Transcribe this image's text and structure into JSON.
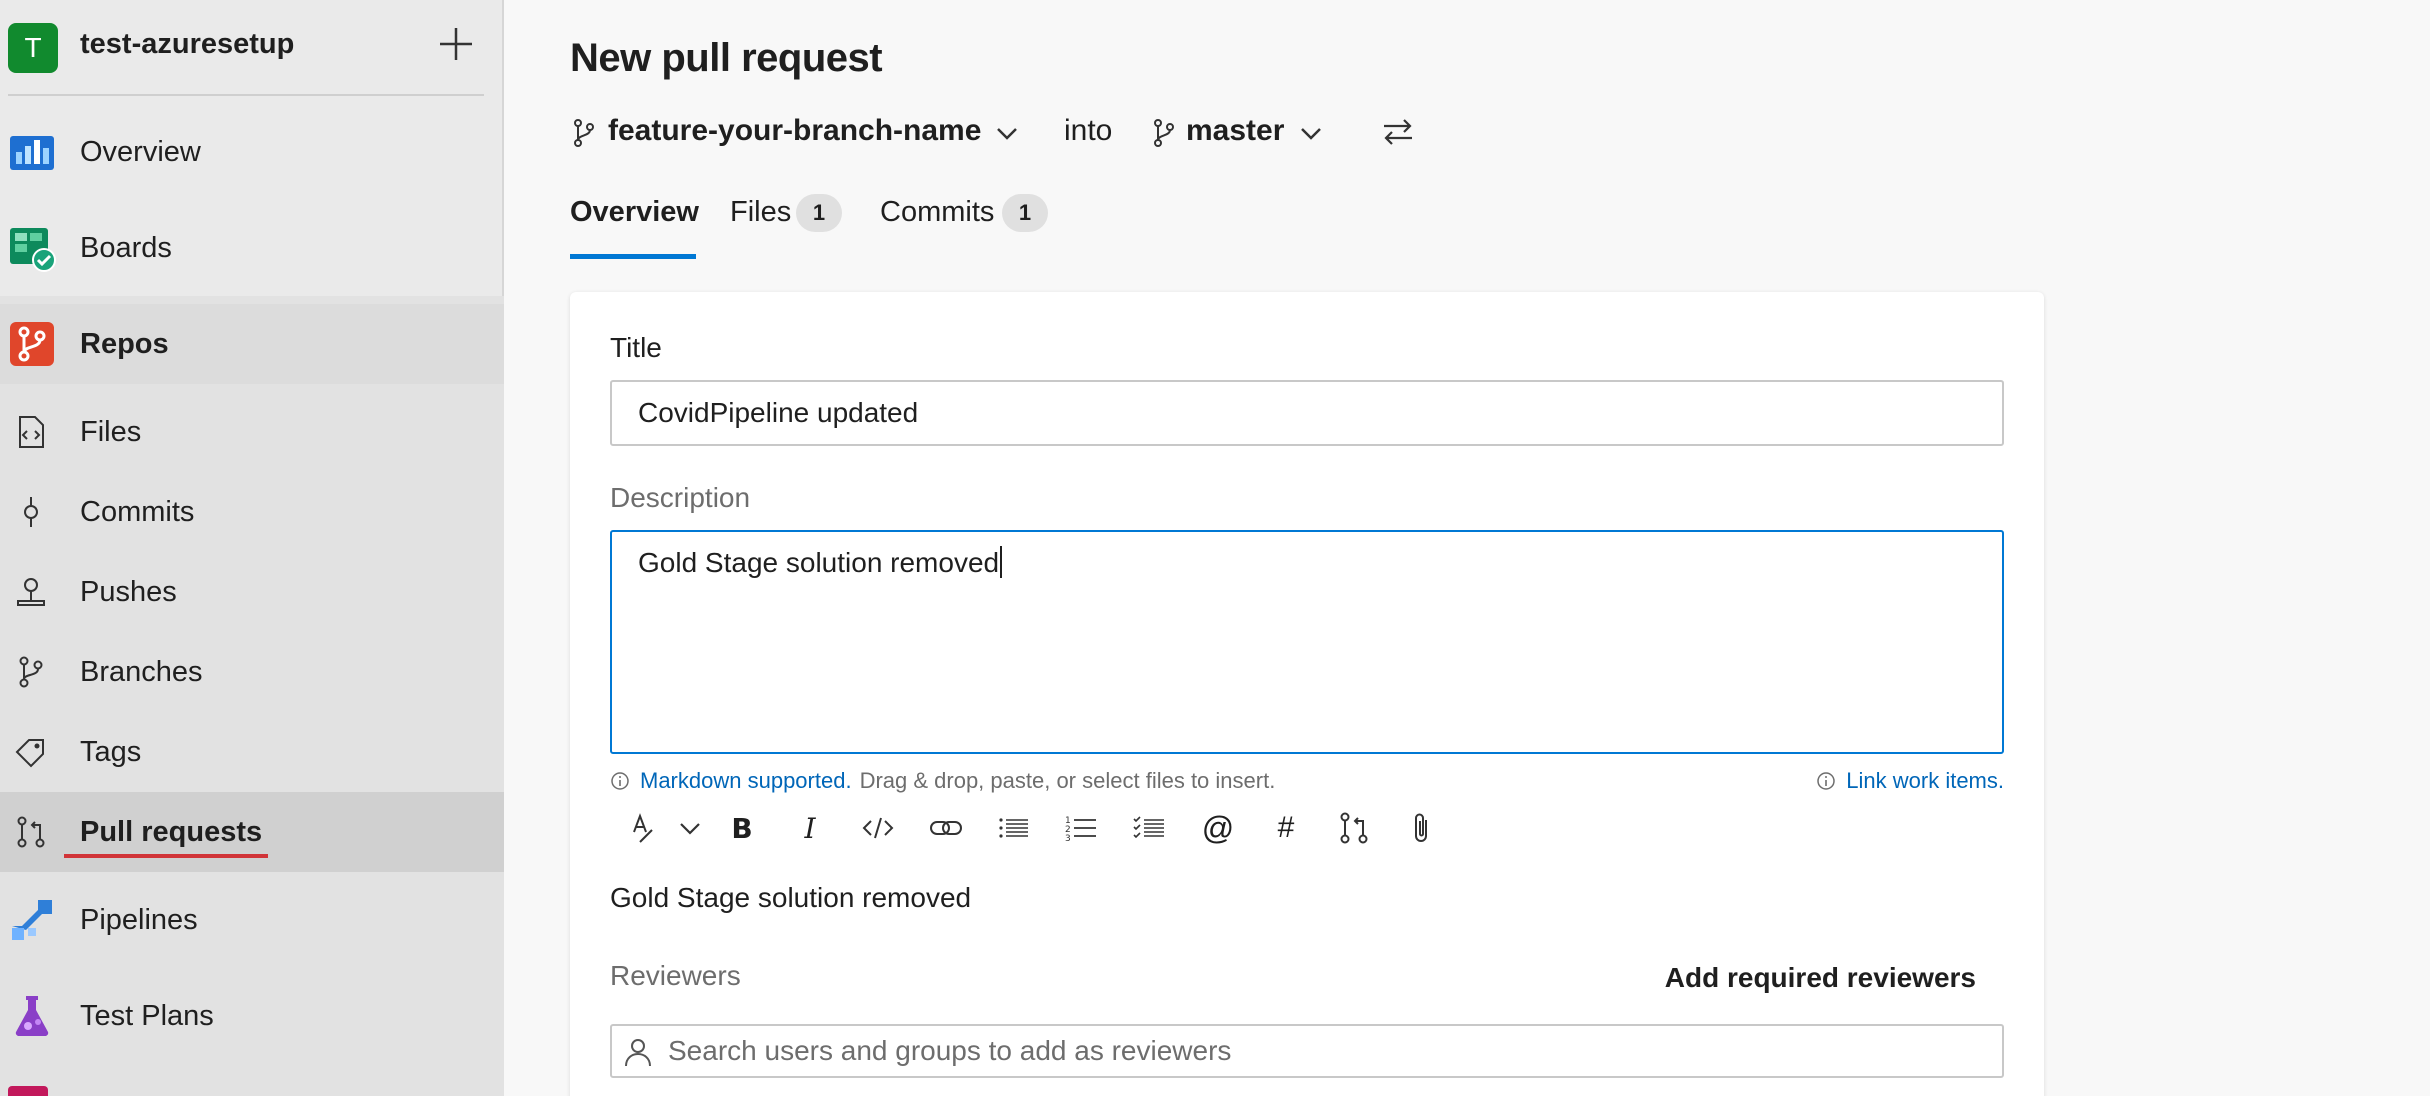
{
  "org": {
    "avatar_letter": "T",
    "name": "test-azuresetup"
  },
  "nav": {
    "overview": "Overview",
    "boards": "Boards",
    "repos": "Repos",
    "files": "Files",
    "commits": "Commits",
    "pushes": "Pushes",
    "branches": "Branches",
    "tags": "Tags",
    "pull_requests": "Pull requests",
    "pipelines": "Pipelines",
    "test_plans": "Test Plans"
  },
  "page": {
    "title": "New pull request",
    "source_branch": "feature-your-branch-name",
    "into": "into",
    "target_branch": "master"
  },
  "tabs": [
    {
      "label": "Overview",
      "active": true
    },
    {
      "label": "Files",
      "count": "1"
    },
    {
      "label": "Commits",
      "count": "1"
    }
  ],
  "form": {
    "title_label": "Title",
    "title_value": "CovidPipeline updated",
    "description_label": "Description",
    "description_value": "Gold Stage solution removed",
    "markdown_link": "Markdown supported.",
    "markdown_hint": "Drag & drop, paste, or select files to insert.",
    "link_work_items": "Link work items.",
    "preview_text": "Gold Stage solution removed",
    "reviewers_label": "Reviewers",
    "add_required_reviewers": "Add required reviewers",
    "reviewers_placeholder": "Search users and groups to add as reviewers"
  },
  "colors": {
    "accent": "#0078d4",
    "active_underline": "#d13438",
    "org_avatar": "#118a2e"
  }
}
